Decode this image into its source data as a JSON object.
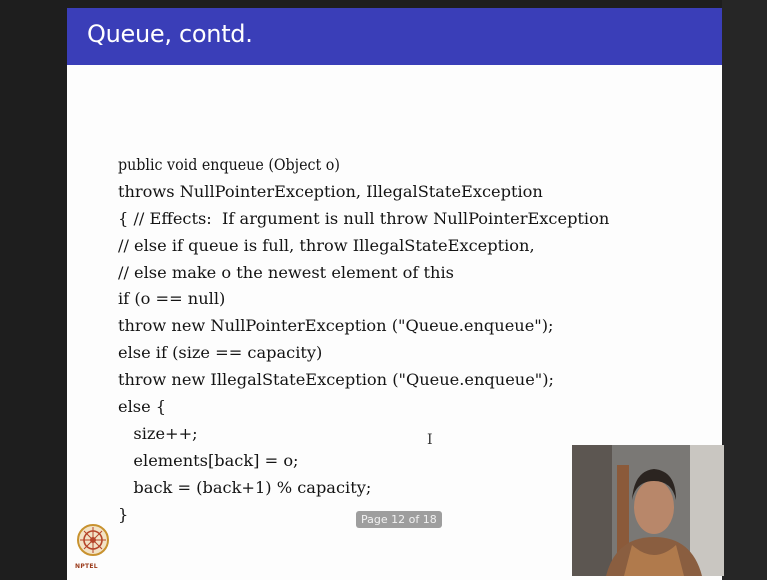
{
  "slide": {
    "title": "Queue, contd.",
    "code_lines": [
      "public void enqueue (Object o)",
      "throws NullPointerException, IllegalStateException",
      "{ // Effects:  If argument is null throw NullPointerException",
      "// else if queue is full, throw IllegalStateException,",
      "// else make o the newest element of this",
      "if (o == null)",
      "throw new NullPointerException (\"Queue.enqueue\");",
      "else if (size == capacity)",
      "throw new IllegalStateException (\"Queue.enqueue\");",
      "else {",
      "   size++;",
      "   elements[back] = o;",
      "   back = (back+1) % capacity;",
      "}"
    ],
    "page_indicator": "Page 12 of 18",
    "logo_text": "NPTEL"
  },
  "colors": {
    "title_bar": "#3a3eb8",
    "slide_bg": "#fdfdfd",
    "frame_bg": "#1e1e1e"
  }
}
